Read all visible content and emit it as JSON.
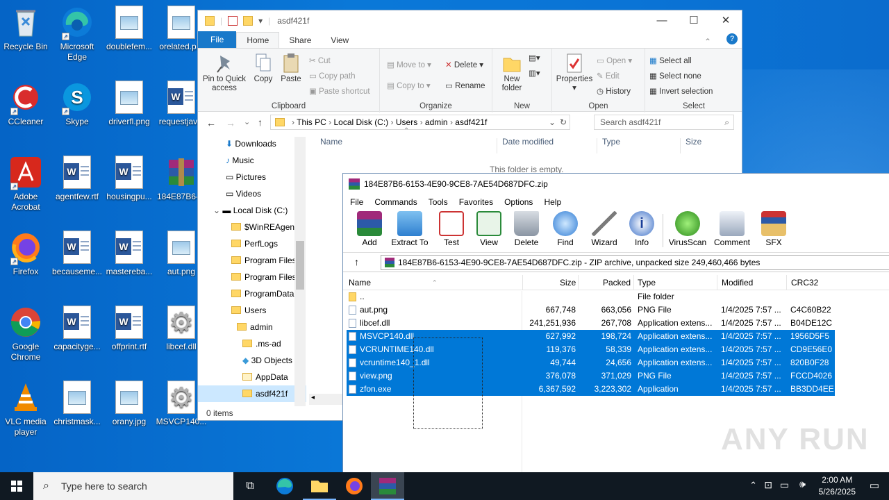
{
  "desktop": {
    "icons": [
      {
        "label": "Recycle Bin"
      },
      {
        "label": "Microsoft Edge"
      },
      {
        "label": "doublefem..."
      },
      {
        "label": "orelated.p..."
      },
      {
        "label": "CCleaner"
      },
      {
        "label": "Skype"
      },
      {
        "label": "driverfl.png"
      },
      {
        "label": "requestjav..."
      },
      {
        "label": "Adobe Acrobat"
      },
      {
        "label": "agentfew.rtf"
      },
      {
        "label": "housingpu..."
      },
      {
        "label": "184E87B6-..."
      },
      {
        "label": "Firefox"
      },
      {
        "label": "becauseme..."
      },
      {
        "label": "mastereba..."
      },
      {
        "label": "aut.png"
      },
      {
        "label": "Google Chrome"
      },
      {
        "label": "capacityge..."
      },
      {
        "label": "offprint.rtf"
      },
      {
        "label": "libcef.dll"
      },
      {
        "label": "VLC media player"
      },
      {
        "label": "christmask..."
      },
      {
        "label": "orany.jpg"
      },
      {
        "label": "MSVCP140..."
      }
    ]
  },
  "explorer": {
    "title": "asdf421f",
    "tabs": {
      "file": "File",
      "home": "Home",
      "share": "Share",
      "view": "View"
    },
    "clipboard": {
      "pin": "Pin to Quick access",
      "copy": "Copy",
      "paste": "Paste",
      "cut": "Cut",
      "copy_path": "Copy path",
      "paste_shortcut": "Paste shortcut",
      "group": "Clipboard"
    },
    "organize": {
      "move_to": "Move to",
      "copy_to": "Copy to",
      "delete": "Delete",
      "rename": "Rename",
      "group": "Organize"
    },
    "new": {
      "new_folder": "New folder",
      "group": "New"
    },
    "open": {
      "properties": "Properties",
      "open": "Open",
      "edit": "Edit",
      "history": "History",
      "group": "Open"
    },
    "select": {
      "select_all": "Select all",
      "select_none": "Select none",
      "invert": "Invert selection",
      "group": "Select"
    },
    "breadcrumb": [
      "This PC",
      "Local Disk (C:)",
      "Users",
      "admin",
      "asdf421f"
    ],
    "search_placeholder": "Search asdf421f",
    "nav": [
      "Downloads",
      "Music",
      "Pictures",
      "Videos",
      "Local Disk (C:)",
      "$WinREAgent",
      "PerfLogs",
      "Program Files",
      "Program Files",
      "ProgramData",
      "Users",
      "admin",
      ".ms-ad",
      "3D Objects",
      "AppData",
      "asdf421f"
    ],
    "columns": {
      "name": "Name",
      "date": "Date modified",
      "type": "Type",
      "size": "Size"
    },
    "empty": "This folder is empty.",
    "status": "0 items"
  },
  "winrar": {
    "title": "184E87B6-6153-4E90-9CE8-7AE54D687DFC.zip",
    "menu": [
      "File",
      "Commands",
      "Tools",
      "Favorites",
      "Options",
      "Help"
    ],
    "tools": [
      "Add",
      "Extract To",
      "Test",
      "View",
      "Delete",
      "Find",
      "Wizard",
      "Info",
      "VirusScan",
      "Comment",
      "SFX"
    ],
    "path": "184E87B6-6153-4E90-9CE8-7AE54D687DFC.zip - ZIP archive, unpacked size 249,460,466 bytes",
    "columns": {
      "name": "Name",
      "size": "Size",
      "packed": "Packed",
      "type": "Type",
      "modified": "Modified",
      "crc": "CRC32"
    },
    "rows": [
      {
        "name": "..",
        "size": "",
        "packed": "",
        "type": "File folder",
        "modified": "",
        "crc": ""
      },
      {
        "name": "aut.png",
        "size": "667,748",
        "packed": "663,056",
        "type": "PNG File",
        "modified": "1/4/2025 7:57 ...",
        "crc": "C4C60B22"
      },
      {
        "name": "libcef.dll",
        "size": "241,251,936",
        "packed": "267,708",
        "type": "Application extens...",
        "modified": "1/4/2025 7:57 ...",
        "crc": "B04DE12C"
      },
      {
        "name": "MSVCP140.dll",
        "size": "627,992",
        "packed": "198,724",
        "type": "Application extens...",
        "modified": "1/4/2025 7:57 ...",
        "crc": "1956D5F5"
      },
      {
        "name": "VCRUNTIME140.dll",
        "size": "119,376",
        "packed": "58,339",
        "type": "Application extens...",
        "modified": "1/4/2025 7:57 ...",
        "crc": "CD9E56E0"
      },
      {
        "name": "vcruntime140_1.dll",
        "size": "49,744",
        "packed": "24,656",
        "type": "Application extens...",
        "modified": "1/4/2025 7:57 ...",
        "crc": "820B0F28"
      },
      {
        "name": "view.png",
        "size": "376,078",
        "packed": "371,029",
        "type": "PNG File",
        "modified": "1/4/2025 7:57 ...",
        "crc": "FCCD4026"
      },
      {
        "name": "zfon.exe",
        "size": "6,367,592",
        "packed": "3,223,302",
        "type": "Application",
        "modified": "1/4/2025 7:57 ...",
        "crc": "BB3DD4EE"
      }
    ],
    "selected_rows": [
      3,
      4,
      5,
      6,
      7
    ]
  },
  "taskbar": {
    "search_placeholder": "Type here to search",
    "time": "2:00 AM",
    "date": "5/26/2025"
  },
  "watermark": "ANY RUN",
  "colors": {
    "selection": "#0078d7",
    "desktop": "#0a74d4",
    "taskbar": "#101922"
  }
}
